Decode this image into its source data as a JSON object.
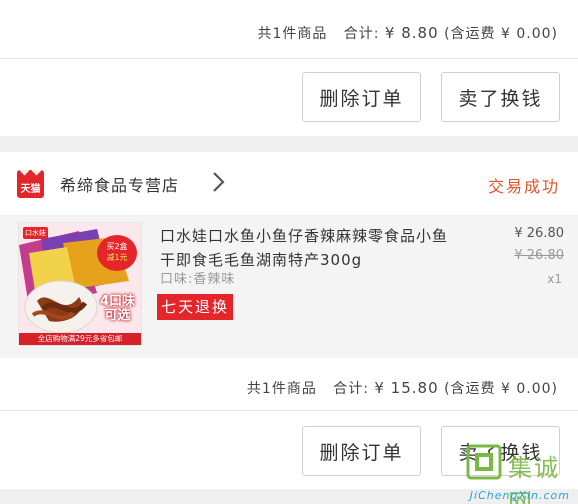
{
  "order1": {
    "summary_count": "共1件商品",
    "summary_total_label": "合计:",
    "summary_total": "¥ 8.80",
    "summary_shipping": "(含运费 ¥ 0.00)",
    "btn_delete": "删除订单",
    "btn_sell": "卖了换钱"
  },
  "order2": {
    "shop_logo_text": "天猫",
    "shop_name": "希缔食品专营店",
    "status": "交易成功",
    "product": {
      "title": "口水娃口水鱼小鱼仔香辣麻辣零食品小鱼干即食毛毛鱼湖南特产300g",
      "variant": "口味:香辣味",
      "tag": "七天退换",
      "price_now": "¥ 26.80",
      "price_old": "¥ 26.80",
      "qty": "x1",
      "thumb": {
        "brand": "口水娃",
        "badge_top": "买2盒",
        "badge_bottom": "减1元",
        "promo_big": "4口味",
        "promo_small": "可选",
        "banner": "全店购物满29元多省包邮"
      }
    },
    "summary_count": "共1件商品",
    "summary_total_label": "合计:",
    "summary_total": "¥ 15.80",
    "summary_shipping": "(含运费 ¥ 0.00)",
    "btn_delete": "删除订单",
    "btn_sell": "卖了换钱"
  },
  "watermark": {
    "cn": "集诚网",
    "url": "JiChengXin.com"
  },
  "colors": {
    "accent_red": "#e4262b",
    "status_orange": "#e8522b",
    "page_bg": "#efefef"
  }
}
